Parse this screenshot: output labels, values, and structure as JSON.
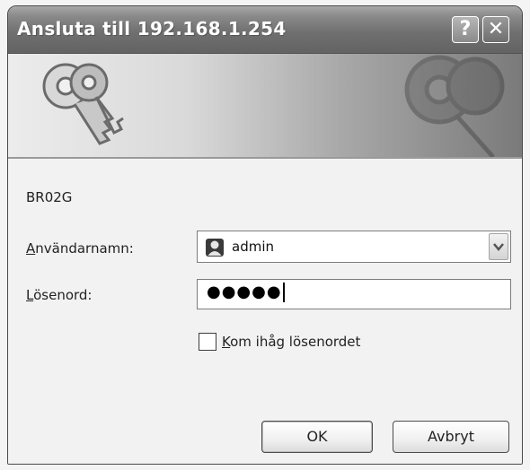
{
  "window": {
    "title": "Ansluta till 192.168.1.254",
    "help_glyph": "?",
    "close_glyph": "✕"
  },
  "banner": {
    "icon": "keys-icon"
  },
  "form": {
    "realm": "BR02G",
    "username_label_accel": "A",
    "username_label_rest": "nvändarnamn:",
    "username_value": "admin",
    "password_label_accel": "L",
    "password_label_rest": "ösenord:",
    "password_value": "●●●●●",
    "remember_label_accel": "K",
    "remember_label_rest": "om ihåg lösenordet",
    "remember_checked": false
  },
  "buttons": {
    "ok_label": "OK",
    "cancel_label": "Avbryt"
  },
  "colors": {
    "titlebar": "#707070",
    "content_bg": "#f2f2f2",
    "field_border": "#7d7d7d"
  }
}
